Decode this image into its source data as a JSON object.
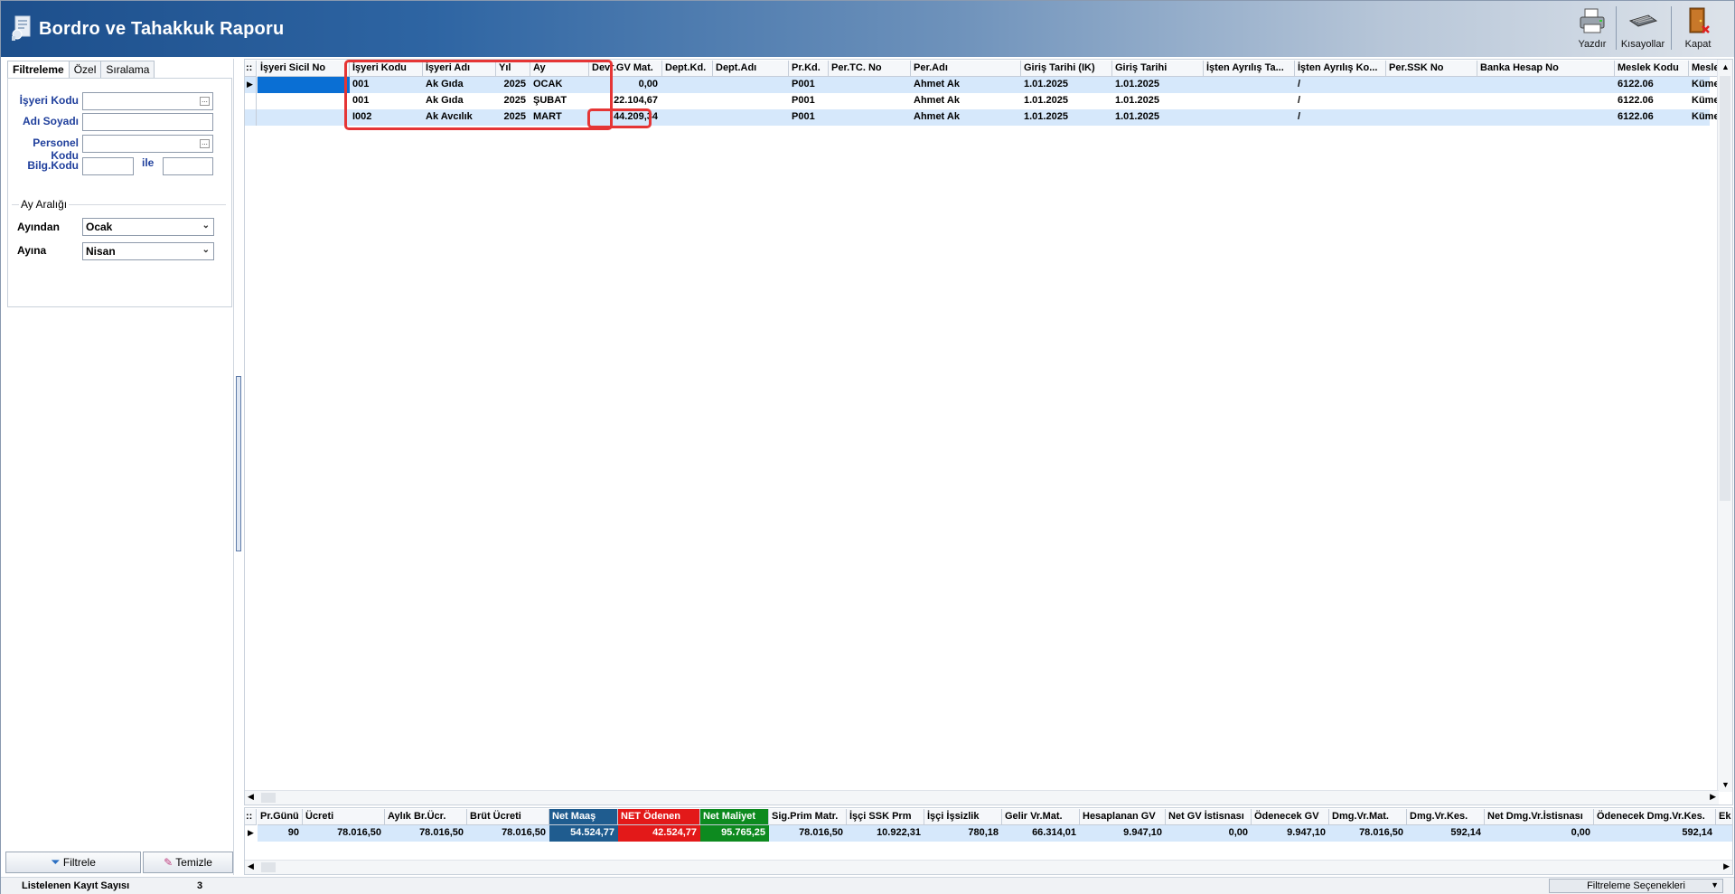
{
  "window": {
    "title": "Bordro ve Tahakkuk Raporu"
  },
  "toolbar": {
    "print_label": "Yazdır",
    "shortcuts_label": "Kısayollar",
    "close_label": "Kapat"
  },
  "left_panel": {
    "tabs": [
      "Filtreleme",
      "Özel",
      "Sıralama"
    ],
    "active_tab": "Filtreleme",
    "fields": {
      "employer_code_label": "İşyeri Kodu",
      "name_label": "Adı Soyadı",
      "personnel_code_label": "Personel Kodu",
      "bilg_code_label": "Bilg.Kodu",
      "between_label": "ile"
    },
    "month_range": {
      "group_title": "Ay Aralığı",
      "from_label": "Ayından",
      "from_value": "Ocak",
      "to_label": "Ayına",
      "to_value": "Nisan"
    },
    "filter_button": "Filtrele",
    "clear_button": "Temizle"
  },
  "grid": {
    "columns": [
      "İşyeri Sicil No",
      "İşyeri Kodu",
      "İşyeri Adı",
      "Yıl",
      "Ay",
      "Devr.GV Mat.",
      "Dept.Kd.",
      "Dept.Adı",
      "Pr.Kd.",
      "Per.TC. No",
      "Per.Adı",
      "Giriş Tarihi (IK)",
      "Giriş Tarihi",
      "İşten Ayrılış Ta...",
      "İşten Ayrılış Ko...",
      "Per.SSK No",
      "Banka Hesap No",
      "Meslek Kodu",
      "Meslek"
    ],
    "rows": [
      [
        "",
        "001",
        "Ak Gıda",
        "2025",
        "OCAK",
        "0,00",
        "",
        "",
        "P001",
        "",
        "Ahmet Ak",
        "1.01.2025",
        "1.01.2025",
        "",
        "/",
        "",
        "",
        "6122.06",
        "Kümes"
      ],
      [
        "",
        "001",
        "Ak Gıda",
        "2025",
        "ŞUBAT",
        "22.104,67",
        "",
        "",
        "P001",
        "",
        "Ahmet Ak",
        "1.01.2025",
        "1.01.2025",
        "",
        "/",
        "",
        "",
        "6122.06",
        "Kümes"
      ],
      [
        "",
        "I002",
        "Ak Avcılık",
        "2025",
        "MART",
        "44.209,34",
        "",
        "",
        "P001",
        "",
        "Ahmet Ak",
        "1.01.2025",
        "1.01.2025",
        "",
        "/",
        "",
        "",
        "6122.06",
        "Kümes"
      ]
    ]
  },
  "summary": {
    "columns": [
      "Pr.Günü",
      "Ücreti",
      "Aylık Br.Ücr.",
      "Brüt Ücreti",
      "Net Maaş",
      "NET Ödenen",
      "Net Maliyet",
      "Sig.Prim Matr.",
      "İşçi SSK Prm",
      "İşçi İşsizlik",
      "Gelir Vr.Mat.",
      "Hesaplanan GV",
      "Net GV İstisnası",
      "Ödenecek GV",
      "Dmg.Vr.Mat.",
      "Dmg.Vr.Kes.",
      "Net Dmg.Vr.İstisnası",
      "Ödenecek Dmg.Vr.Kes.",
      "Ek İ"
    ],
    "values": [
      "90",
      "78.016,50",
      "78.016,50",
      "78.016,50",
      "54.524,77",
      "42.524,77",
      "95.765,25",
      "78.016,50",
      "10.922,31",
      "780,18",
      "66.314,01",
      "9.947,10",
      "0,00",
      "9.947,10",
      "78.016,50",
      "592,14",
      "0,00",
      "592,14",
      ""
    ],
    "highlight_colors": {
      "net_maas": "#1f5c8f",
      "net_odenen": "#e31919",
      "net_maliyet": "#0d8a1f"
    }
  },
  "status": {
    "count_label": "Listelenen Kayıt Sayısı",
    "count_value": "3",
    "filter_options_button": "Filtreleme Seçenekleri"
  }
}
